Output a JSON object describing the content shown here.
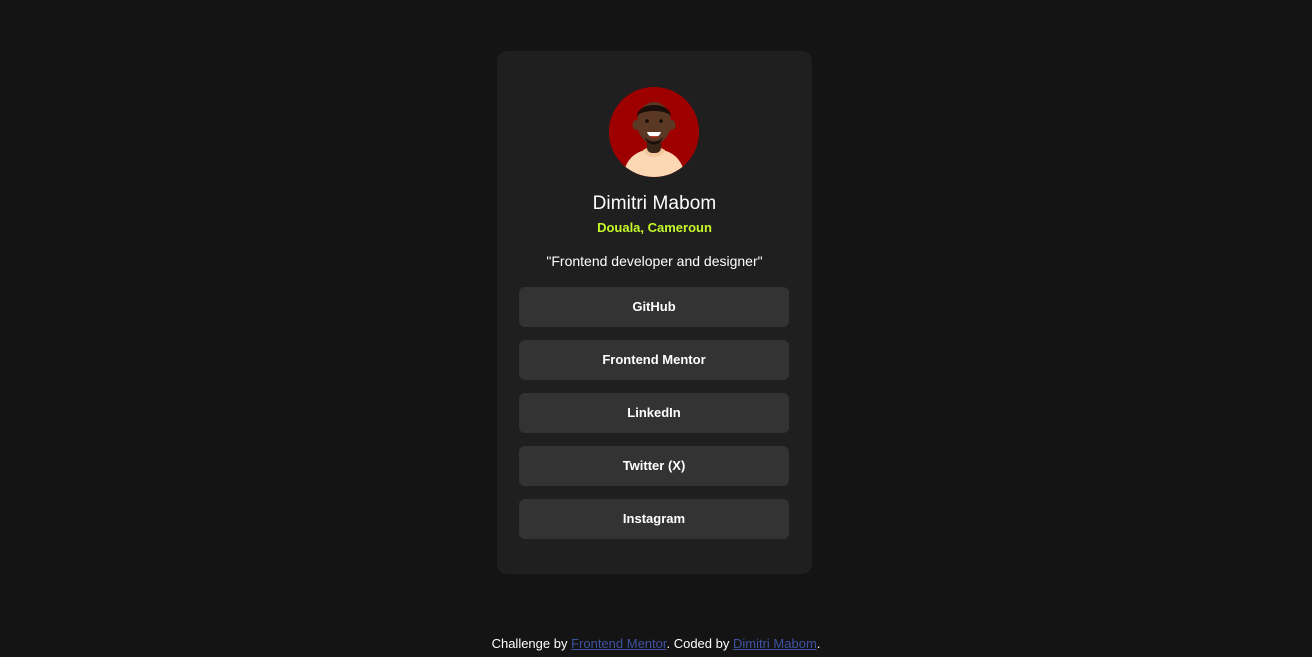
{
  "profile": {
    "name": "Dimitri Mabom",
    "location": "Douala, Cameroun",
    "bio": "\"Frontend developer and designer\""
  },
  "links": [
    {
      "label": "GitHub"
    },
    {
      "label": "Frontend Mentor"
    },
    {
      "label": "LinkedIn"
    },
    {
      "label": "Twitter (X)"
    },
    {
      "label": "Instagram"
    }
  ],
  "footer": {
    "prefix": "Challenge by",
    "link1": "Frontend Mentor",
    "middle": ". Coded by",
    "link2": "Dimitri Mabom",
    "suffix": "."
  },
  "colors": {
    "page_background": "#141414",
    "card_background": "#1f1f1f",
    "button_background": "#333333",
    "accent_green": "#c4f82a",
    "footer_link": "#3e52a3",
    "avatar_background": "#9e0000"
  }
}
